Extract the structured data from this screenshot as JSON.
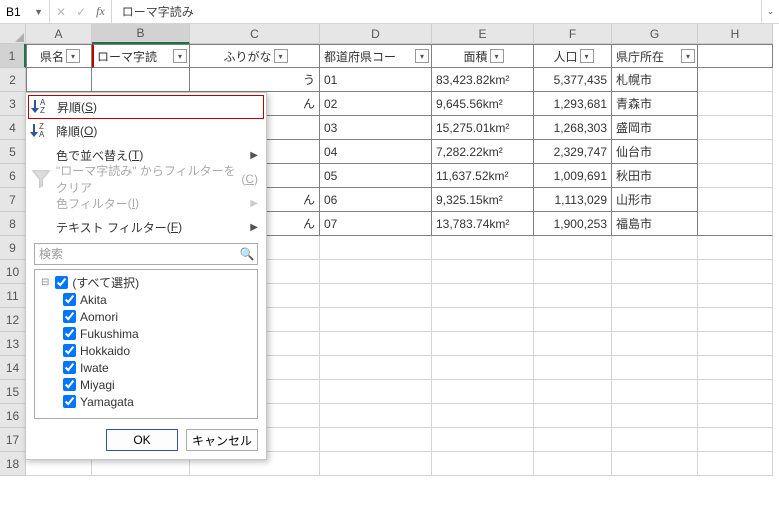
{
  "formula_bar": {
    "cell_ref": "B1",
    "formula": "ローマ字読み",
    "cancel": "✕",
    "confirm": "✓",
    "fx": "fx"
  },
  "columns": [
    "A",
    "B",
    "C",
    "D",
    "E",
    "F",
    "G",
    "H"
  ],
  "rows": [
    "1",
    "2",
    "3",
    "4",
    "5",
    "6",
    "7",
    "8",
    "9",
    "10",
    "11",
    "12",
    "13",
    "14",
    "15",
    "16",
    "17",
    "18"
  ],
  "headers": {
    "A": "県名",
    "B": "ローマ字読",
    "C": "ふりがな",
    "D": "都道府県コー",
    "E": "面積",
    "F": "人口",
    "G": "県庁所在"
  },
  "table": [
    {
      "c": "う",
      "d": "01",
      "e": "83,423.82km²",
      "f": "5,377,435",
      "g": "札幌市"
    },
    {
      "c": "ん",
      "d": "02",
      "e": "9,645.56km²",
      "f": "1,293,681",
      "g": "青森市"
    },
    {
      "c": "",
      "d": "03",
      "e": "15,275.01km²",
      "f": "1,268,303",
      "g": "盛岡市"
    },
    {
      "c": "",
      "d": "04",
      "e": "7,282.22km²",
      "f": "2,329,747",
      "g": "仙台市"
    },
    {
      "c": "",
      "d": "05",
      "e": "11,637.52km²",
      "f": "1,009,691",
      "g": "秋田市"
    },
    {
      "c": "ん",
      "d": "06",
      "e": "9,325.15km²",
      "f": "1,113,029",
      "g": "山形市"
    },
    {
      "c": "ん",
      "d": "07",
      "e": "13,783.74km²",
      "f": "1,900,253",
      "g": "福島市"
    }
  ],
  "menu": {
    "sort_asc": "昇順",
    "sort_asc_accel": "S",
    "sort_desc": "降順",
    "sort_desc_accel": "O",
    "sort_color": "色で並べ替え",
    "sort_color_accel": "T",
    "clear_filter_pre": "\"ローマ字読み\" からフィルターをクリア",
    "clear_filter_accel": "C",
    "color_filter": "色フィルター",
    "color_filter_accel": "I",
    "text_filter": "テキスト フィルター",
    "text_filter_accel": "F",
    "search_placeholder": "検索",
    "select_all": "(すべて選択)",
    "items": [
      "Akita",
      "Aomori",
      "Fukushima",
      "Hokkaido",
      "Iwate",
      "Miyagi",
      "Yamagata"
    ],
    "ok": "OK",
    "cancel": "キャンセル"
  }
}
